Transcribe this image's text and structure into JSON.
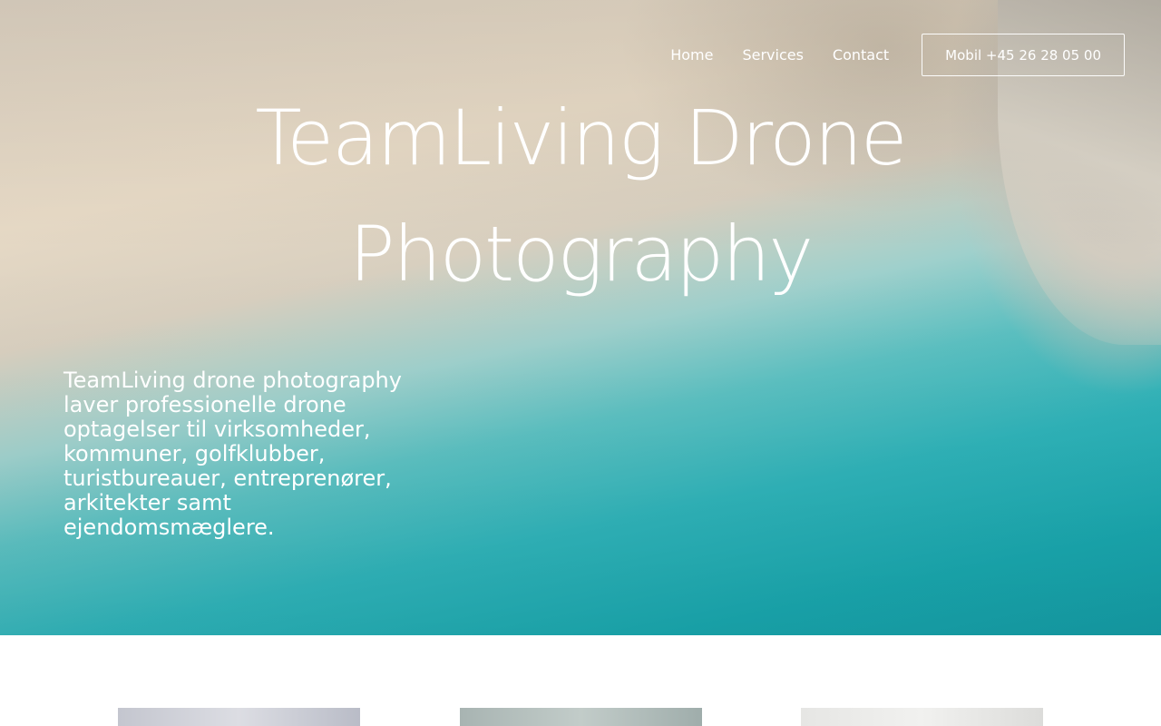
{
  "nav": {
    "items": [
      {
        "label": "Home"
      },
      {
        "label": "Services"
      },
      {
        "label": "Contact"
      }
    ],
    "phone_button": "Mobil +45 26 28 05 00"
  },
  "hero": {
    "title": "TeamLiving Drone Photography",
    "description": "TeamLiving drone photography laver professionelle drone optagelser til virksomheder, kommuner, golfklubber, turistbureauer, entreprenører, arkitekter samt ejendomsmæglere."
  },
  "colors": {
    "sand": "#e6d9c5",
    "water": "#19a5ac",
    "text_on_hero": "#ffffff"
  }
}
